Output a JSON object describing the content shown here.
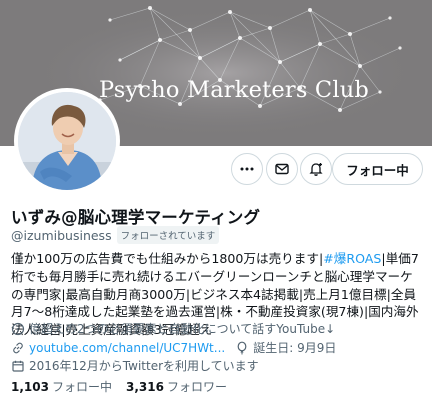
{
  "banner": {
    "title": "Psycho Marketers Club"
  },
  "actions": {
    "more_label": "···",
    "follow_label": "フォロー中"
  },
  "profile": {
    "name": "いずみ@脳心理学マーケティング",
    "handle": "@izumibusiness",
    "follows_you": "フォローされています",
    "bio_parts": {
      "p1": "僅か100万の広告費でも仕組みから1800万は売ります|",
      "tag": "#爆ROAS",
      "p2": "|単価7桁でも毎月勝手に売れ続けるエバーグリーンローンチと脳心理学マーケの専門家|最高自動月商3000万|ビジネス本4誌掲載|売上月1億目標|全員月7〜8桁達成した起業塾を過去運営|株・不動産投資家(現7棟)|国内海外法人経営|売上資産融資額3冠億超え"
    },
    "category": "億超えの2つの必須要素と自動化について話すYouTube↓",
    "link": "youtube.com/channel/UC7HWt...",
    "birthday": "誕生日: 9月9日",
    "joined": "2016年12月からTwitterを利用しています"
  },
  "stats": {
    "following_count": "1,103",
    "following_label": "フォロー中",
    "followers_count": "3,316",
    "followers_label": "フォロワー"
  },
  "colors": {
    "accent": "#1d9bf0",
    "banner": "#7d7b7c"
  },
  "icons": [
    "more-icon",
    "message-icon",
    "notification-bell-icon",
    "info-icon",
    "link-icon",
    "balloon-icon",
    "calendar-icon"
  ]
}
